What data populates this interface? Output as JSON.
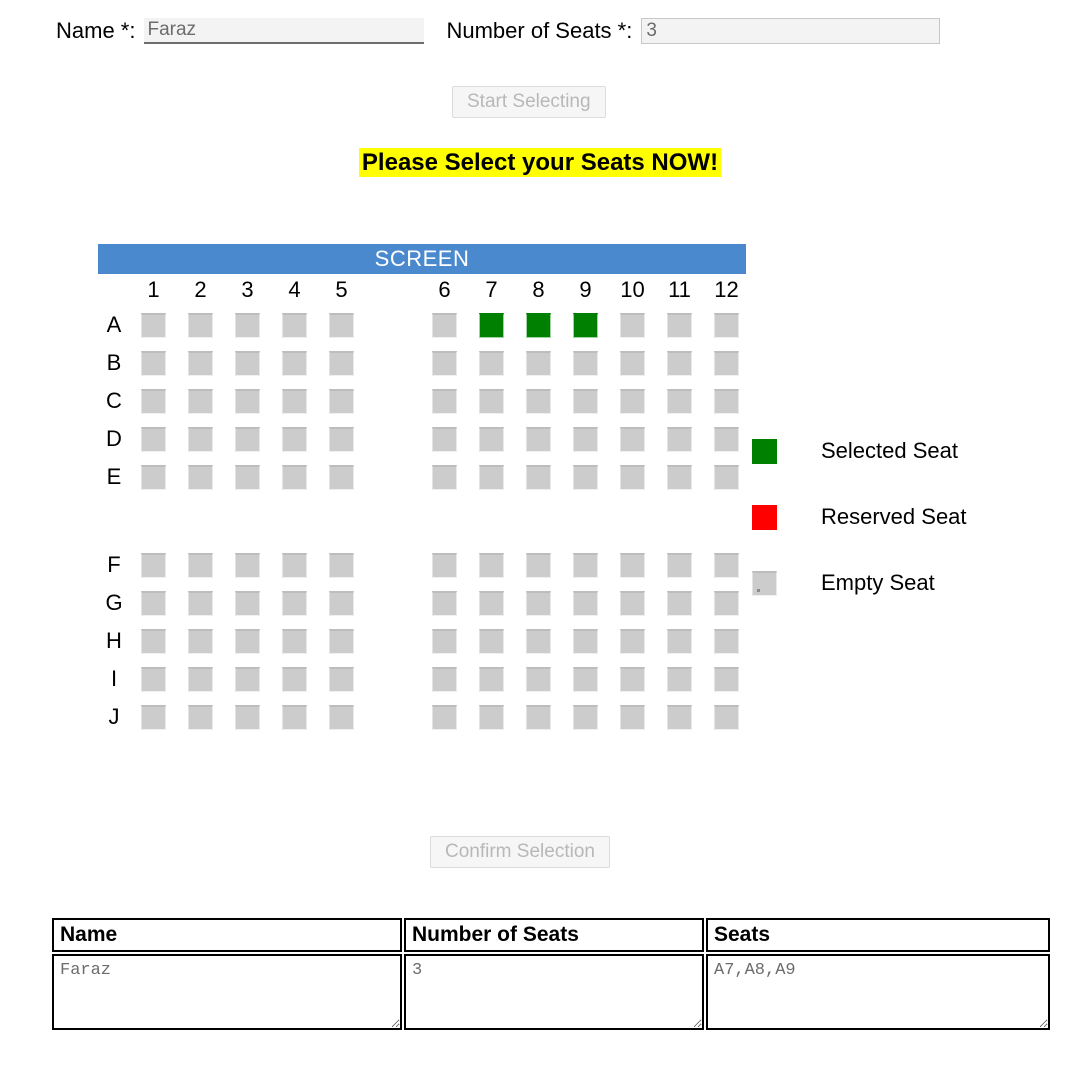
{
  "form": {
    "name_label": "Name *:",
    "name_value": "Faraz",
    "name_placeholder": "",
    "seats_label": "Number of Seats *:",
    "seats_value": "3",
    "seats_placeholder": "",
    "start_button_label": "Start Selecting"
  },
  "banner": {
    "message": "Please Select your Seats NOW!",
    "highlight_color": "#ffff00"
  },
  "chart": {
    "screen_label": "SCREEN",
    "screen_color": "#4a89ce",
    "columns_left": [
      "1",
      "2",
      "3",
      "4",
      "5"
    ],
    "columns_right": [
      "6",
      "7",
      "8",
      "9",
      "10",
      "11",
      "12"
    ],
    "rows_block_top": [
      "A",
      "B",
      "C",
      "D",
      "E"
    ],
    "rows_block_bottom": [
      "F",
      "G",
      "H",
      "I",
      "J"
    ],
    "selected_seats": [
      "A7",
      "A8",
      "A9"
    ],
    "reserved_seats": [],
    "seat_colors": {
      "selected": "#008000",
      "reserved": "#ff0000",
      "empty": "#cccccc"
    }
  },
  "legend": {
    "items": [
      {
        "label": "Selected Seat",
        "swatch": "green",
        "icon": "green-square-icon"
      },
      {
        "label": "Reserved Seat",
        "swatch": "red",
        "icon": "red-square-icon"
      },
      {
        "label": "Empty Seat",
        "swatch": "gray",
        "icon": "gray-square-icon"
      }
    ]
  },
  "confirm": {
    "button_label": "Confirm Selection"
  },
  "results": {
    "headers": [
      "Name",
      "Number of Seats",
      "Seats"
    ],
    "rows": [
      {
        "name": "Faraz",
        "number_of_seats": "3",
        "seats": "A7,A8,A9"
      }
    ]
  }
}
